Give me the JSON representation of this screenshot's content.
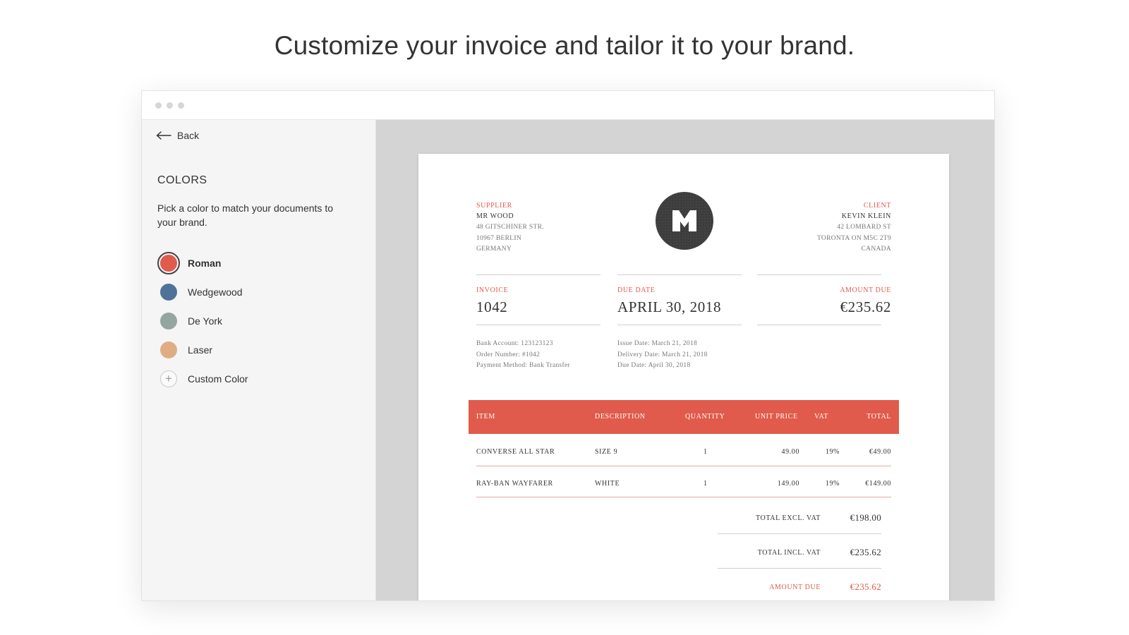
{
  "headline": "Customize your invoice and tailor it to your brand.",
  "sidebar": {
    "back_label": "Back",
    "colors_title": "COLORS",
    "colors_description": "Pick a color to match your documents to your brand.",
    "colors": [
      {
        "label": "Roman",
        "hex": "#e05b4b",
        "selected": true
      },
      {
        "label": "Wedgewood",
        "hex": "#4f7398",
        "selected": false
      },
      {
        "label": "De York",
        "hex": "#94a69f",
        "selected": false
      },
      {
        "label": "Laser",
        "hex": "#e0ad82",
        "selected": false
      }
    ],
    "custom_color_label": "Custom Color"
  },
  "invoice": {
    "accent": "#e05b4b",
    "supplier": {
      "label": "SUPPLIER",
      "name": "MR WOOD",
      "line1": "48 GITSCHINER STR.",
      "line2": "10967 BERLIN",
      "line3": "GERMANY"
    },
    "client": {
      "label": "CLIENT",
      "name": "KEVIN KLEIN",
      "line1": "42 LOMBARD ST",
      "line2": "TORONTA ON M5C 2T9",
      "line3": "CANADA"
    },
    "meta": {
      "invoice_label": "INVOICE",
      "invoice_number": "1042",
      "due_label": "DUE DATE",
      "due_date": "APRIL 30, 2018",
      "amount_label": "AMOUNT DUE",
      "amount": "€235.62"
    },
    "details_left": {
      "line1": "Bank Account: 123123123",
      "line2": "Order Number: #1042",
      "line3": "Payment Method: Bank Transfer"
    },
    "details_mid": {
      "line1": "Issue Date: March 21, 2018",
      "line2": "Delivery Date: March 21, 2018",
      "line3": "Due Date: April 30, 2018"
    },
    "table": {
      "headers": {
        "item": "ITEM",
        "description": "DESCRIPTION",
        "quantity": "QUANTITY",
        "unit_price": "UNIT PRICE",
        "vat": "VAT",
        "total": "TOTAL"
      },
      "rows": [
        {
          "item": "CONVERSE ALL STAR",
          "description": "SIZE 9",
          "quantity": "1",
          "unit_price": "49.00",
          "vat": "19%",
          "total": "€49.00"
        },
        {
          "item": "RAY-BAN WAYFARER",
          "description": "WHITE",
          "quantity": "1",
          "unit_price": "149.00",
          "vat": "19%",
          "total": "€149.00"
        }
      ]
    },
    "totals": {
      "excl_label": "TOTAL EXCL. VAT",
      "excl_value": "€198.00",
      "incl_label": "TOTAL INCL. VAT",
      "incl_value": "€235.62",
      "due_label": "AMOUNT DUE",
      "due_value": "€235.62"
    }
  }
}
